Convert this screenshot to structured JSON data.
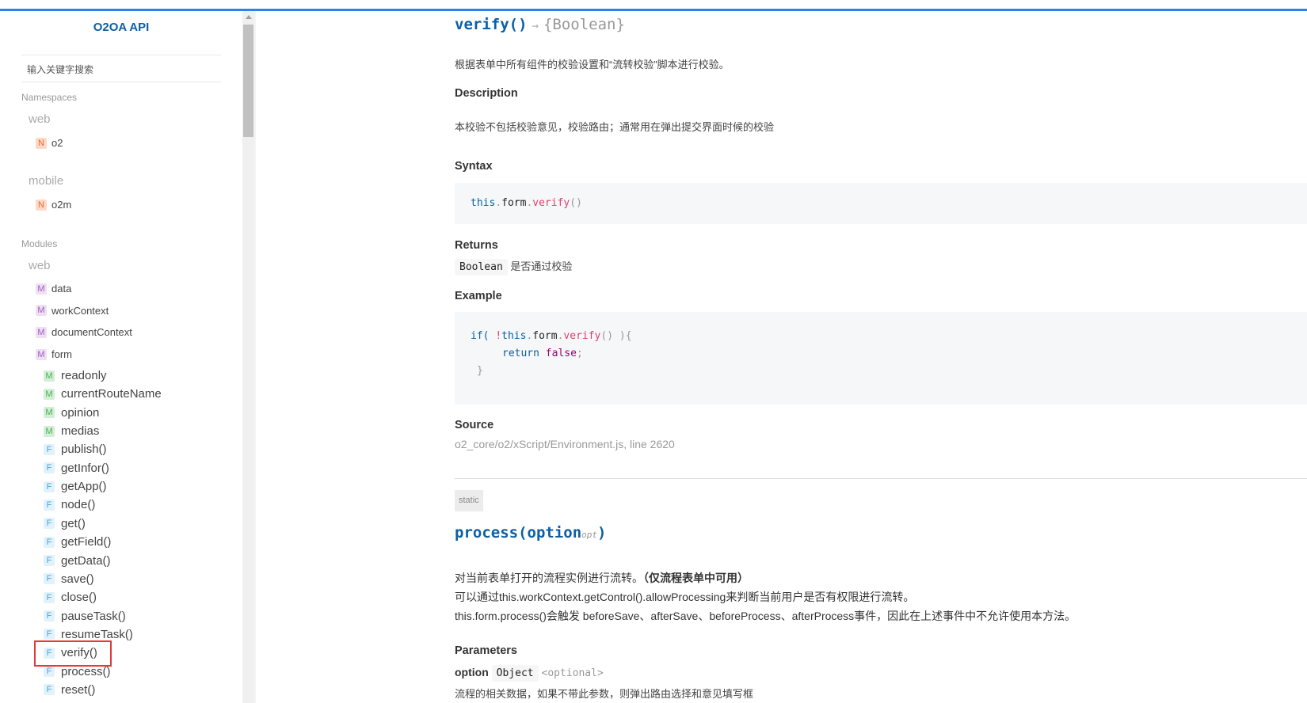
{
  "colors": {
    "accent": "#2f80ed",
    "title": "#0b5fa5",
    "highlight": "#e53935"
  },
  "sidebar": {
    "title": "O2OA API",
    "search_placeholder": "输入关键字搜索",
    "namespaces_label": "Namespaces",
    "ns_web": "web",
    "ns_web_item": "o2",
    "ns_mobile": "mobile",
    "ns_mobile_item": "o2m",
    "modules_label": "Modules",
    "mod_web": "web",
    "badges": {
      "N": "N",
      "M": "M",
      "F": "F"
    },
    "modules": [
      "data",
      "workContext",
      "documentContext",
      "form"
    ],
    "form_members": [
      "readonly",
      "currentRouteName",
      "opinion",
      "medias"
    ],
    "form_functions": [
      "publish()",
      "getInfor()",
      "getApp()",
      "node()",
      "get()",
      "getField()",
      "getData()",
      "save()",
      "close()",
      "pauseTask()",
      "resumeTask()",
      "verify()",
      "process()",
      "reset()"
    ],
    "selected": "verify()"
  },
  "verify": {
    "name": "verify()",
    "arrow": "→",
    "returns_type": "{Boolean}",
    "summary": "根据表单中所有组件的校验设置和“流转校验”脚本进行校验。",
    "description_heading": "Description",
    "description": "本校验不包括校验意见，校验路由；通常用在弹出提交界面时候的校验",
    "syntax_heading": "Syntax",
    "syntax": {
      "this": "this",
      "dot1": ".",
      "form": "form",
      "dot2": ".",
      "fn": "verify",
      "paren": "()"
    },
    "returns_heading": "Returns",
    "returns_chip": "Boolean",
    "returns_desc": "是否通过校验",
    "example_heading": "Example",
    "example": {
      "l1a": "if( ",
      "l1b": "!",
      "l1c": "this",
      ".": ".",
      "l1d": "form",
      "l1e": "verify",
      "l1f": "() ){",
      "l2a": "return",
      "l2b": "false",
      ";": ";",
      "l3": "}"
    },
    "source_heading": "Source",
    "source": "o2_core/o2/xScript/Environment.js, line 2620"
  },
  "process": {
    "static_badge": "static",
    "name": "process(option",
    "opt": "opt",
    "close": ")",
    "p1": "对当前表单打开的流程实例进行流转。",
    "p1_bold": "（仅流程表单中可用）",
    "p2": "可以通过this.workContext.getControl().allowProcessing来判断当前用户是否有权限进行流转。",
    "p3": "this.form.process()会触发 beforeSave、afterSave、beforeProcess、afterProcess事件，因此在上述事件中不允许使用本方法。",
    "parameters_heading": "Parameters",
    "param_name": "option",
    "param_type": "Object",
    "param_optional": "<optional>",
    "param_desc": "流程的相关数据，如果不带此参数，则弹出路由选择和意见填写框"
  }
}
